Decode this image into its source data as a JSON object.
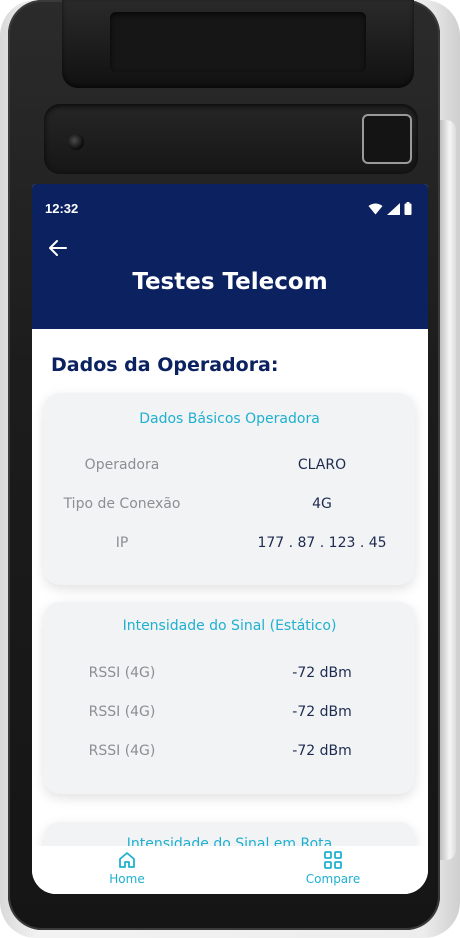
{
  "status_bar": {
    "time": "12:32"
  },
  "app_bar": {
    "title": "Testes Telecom"
  },
  "section": {
    "heading": "Dados da Operadora:"
  },
  "cards": [
    {
      "title": "Dados Básicos Operadora",
      "rows": [
        {
          "label": "Operadora",
          "value": "CLARO"
        },
        {
          "label": "Tipo de Conexão",
          "value": "4G"
        },
        {
          "label": "IP",
          "value": "177 . 87 . 123 . 45"
        }
      ]
    },
    {
      "title": "Intensidade do Sinal (Estático)",
      "rows": [
        {
          "label": "RSSI (4G)",
          "value": "-72 dBm"
        },
        {
          "label": "RSSI (4G)",
          "value": "-72 dBm"
        },
        {
          "label": "RSSI (4G)",
          "value": "-72 dBm"
        }
      ]
    },
    {
      "title": "Intensidade do Sinal em Rota"
    }
  ],
  "bottom_nav": {
    "items": [
      {
        "label": "Home",
        "icon": "home-icon"
      },
      {
        "label": "Compare",
        "icon": "grid-icon"
      }
    ]
  },
  "colors": {
    "app_bar": "#0c2160",
    "accent": "#1fb0d0",
    "heading": "#0c2160",
    "card_bg": "#f2f3f5"
  }
}
